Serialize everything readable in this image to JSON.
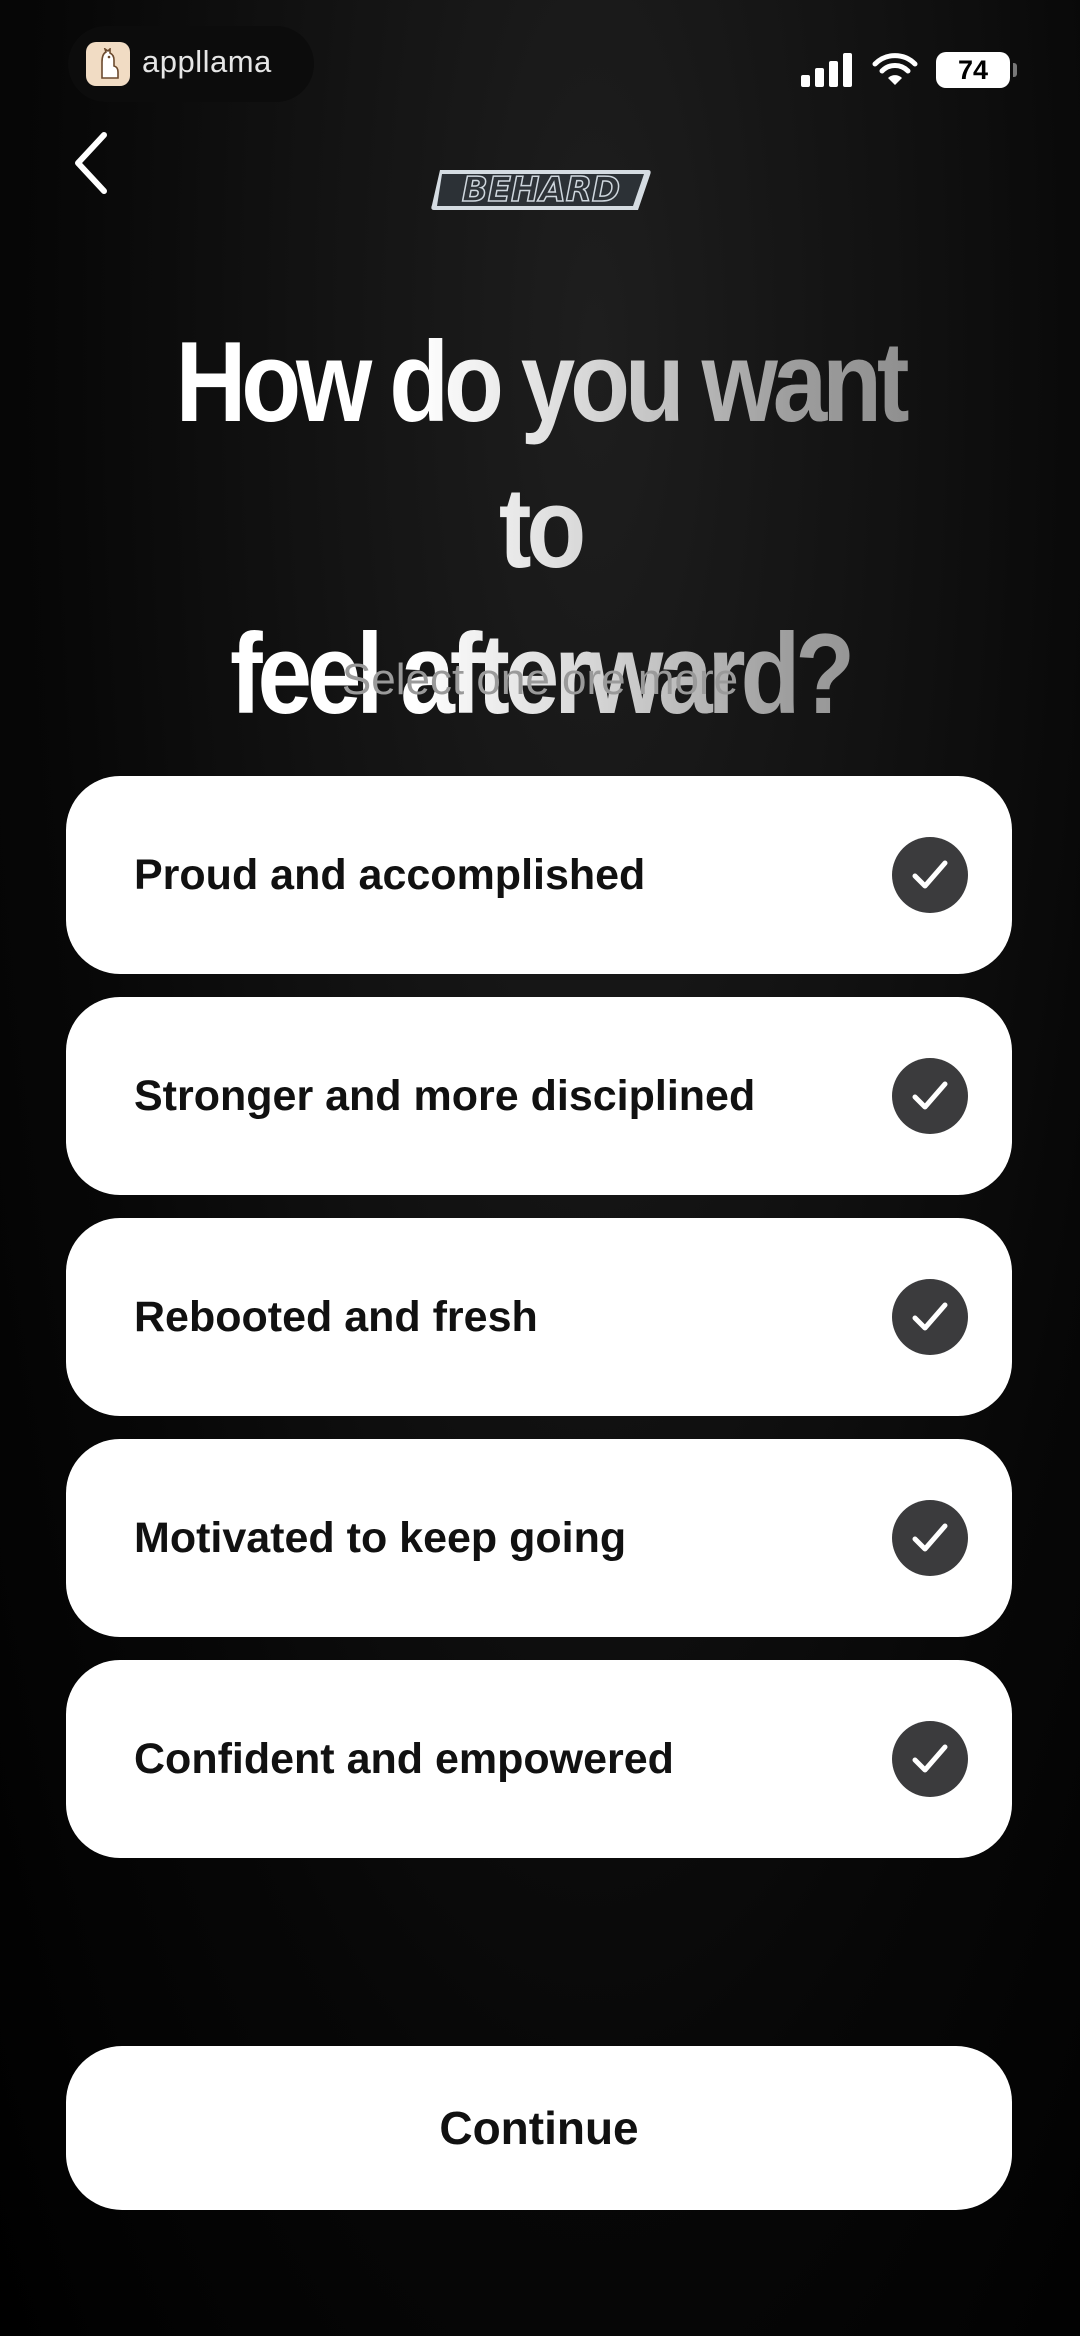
{
  "status_bar": {
    "app_name": "appllama",
    "battery_level": "74",
    "icons": [
      "llama-icon",
      "signal-icon",
      "wifi-icon",
      "battery-icon"
    ]
  },
  "nav": {
    "back_icon": "chevron-left-icon",
    "brand": "BEHARD"
  },
  "question": {
    "line1": "How do you want to",
    "line2": "feel afterward?",
    "subtitle": "Select one ore more"
  },
  "options": [
    {
      "label": "Proud and accomplished",
      "selected": true
    },
    {
      "label": "Stronger and more disciplined",
      "selected": true
    },
    {
      "label": "Rebooted and fresh",
      "selected": true
    },
    {
      "label": "Motivated to keep going",
      "selected": true
    },
    {
      "label": "Confident and empowered",
      "selected": true
    }
  ],
  "continue_label": "Continue",
  "colors": {
    "background": "#000000",
    "card": "#ffffff",
    "check_circle": "#3b3b3d",
    "subtitle": "#9a9a9a"
  }
}
